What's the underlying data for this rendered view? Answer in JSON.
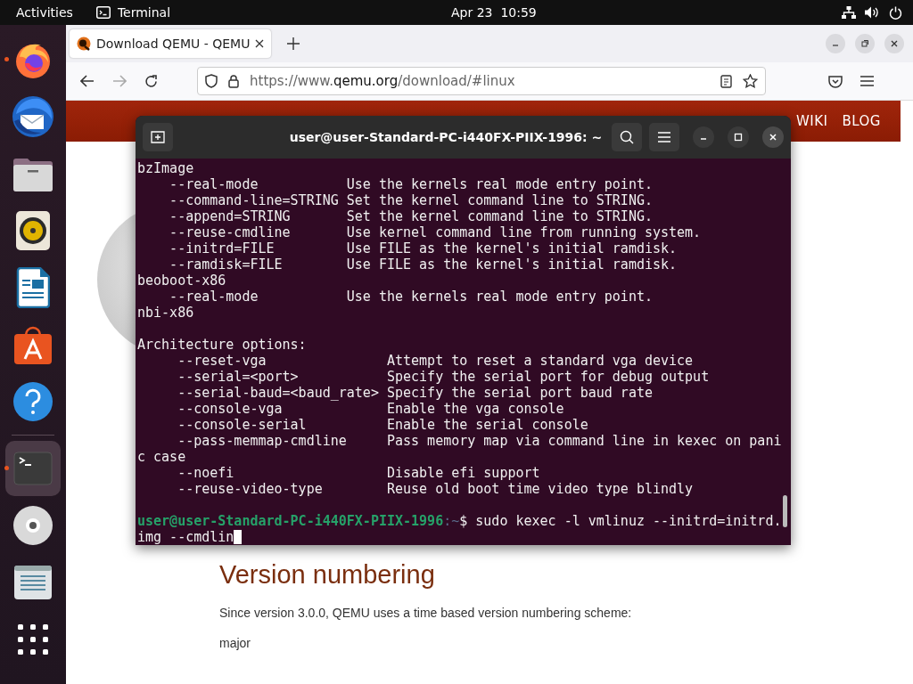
{
  "top_bar": {
    "activities": "Activities",
    "app_name": "Terminal",
    "clock": "Apr 23  10:59"
  },
  "dock": {
    "items": [
      {
        "kind": "firefox",
        "running": true,
        "selected": false
      },
      {
        "kind": "thunderbird",
        "running": false,
        "selected": false
      },
      {
        "kind": "files",
        "running": false,
        "selected": false
      },
      {
        "kind": "rhythmbox",
        "running": false,
        "selected": false
      },
      {
        "kind": "writer",
        "running": false,
        "selected": false
      },
      {
        "kind": "software",
        "running": false,
        "selected": false
      },
      {
        "kind": "help",
        "running": false,
        "selected": false
      },
      {
        "kind": "terminal",
        "running": true,
        "selected": true
      },
      {
        "kind": "disc",
        "running": false,
        "selected": false
      },
      {
        "kind": "document",
        "running": false,
        "selected": false
      },
      {
        "kind": "apps",
        "running": false,
        "selected": false
      }
    ]
  },
  "browser": {
    "tabs": [
      {
        "title": "Download QEMU - QEMU",
        "selected": true
      }
    ],
    "url": {
      "prefix": "https://www.",
      "domain": "qemu.org",
      "path": "/download/#linux"
    },
    "page": {
      "nav": [
        "WIKI",
        "BLOG"
      ],
      "heading": "Version numbering",
      "paragraph": "Since version 3.0.0, QEMU uses a time based version numbering scheme:",
      "list_item": "major"
    }
  },
  "terminal": {
    "title": "user@user-Standard-PC-i440FX-PIIX-1996: ~",
    "lines": [
      "bzImage",
      "    --real-mode           Use the kernels real mode entry point.",
      "    --command-line=STRING Set the kernel command line to STRING.",
      "    --append=STRING       Set the kernel command line to STRING.",
      "    --reuse-cmdline       Use kernel command line from running system.",
      "    --initrd=FILE         Use FILE as the kernel's initial ramdisk.",
      "    --ramdisk=FILE        Use FILE as the kernel's initial ramdisk.",
      "beoboot-x86",
      "    --real-mode           Use the kernels real mode entry point.",
      "nbi-x86",
      {
        "kind": "blank"
      },
      "Architecture options:",
      "     --reset-vga               Attempt to reset a standard vga device",
      "     --serial=<port>           Specify the serial port for debug output",
      "     --serial-baud=<baud_rate> Specify the serial port baud rate",
      "     --console-vga             Enable the vga console",
      "     --console-serial          Enable the serial console",
      "     --pass-memmap-cmdline     Pass memory map via command line in kexec on pani",
      "c case",
      "     --noefi                   Disable efi support",
      "     --reuse-video-type        Reuse old boot time video type blindly",
      {
        "kind": "blank"
      }
    ],
    "prompt": {
      "user_host": "user@user-Standard-PC-i440FX-PIIX-1996",
      "path": ":~",
      "symbol": "$",
      "command": "sudo kexec -l vmlinuz --initrd=initrd."
    },
    "continuation": "img --cmdlin"
  }
}
